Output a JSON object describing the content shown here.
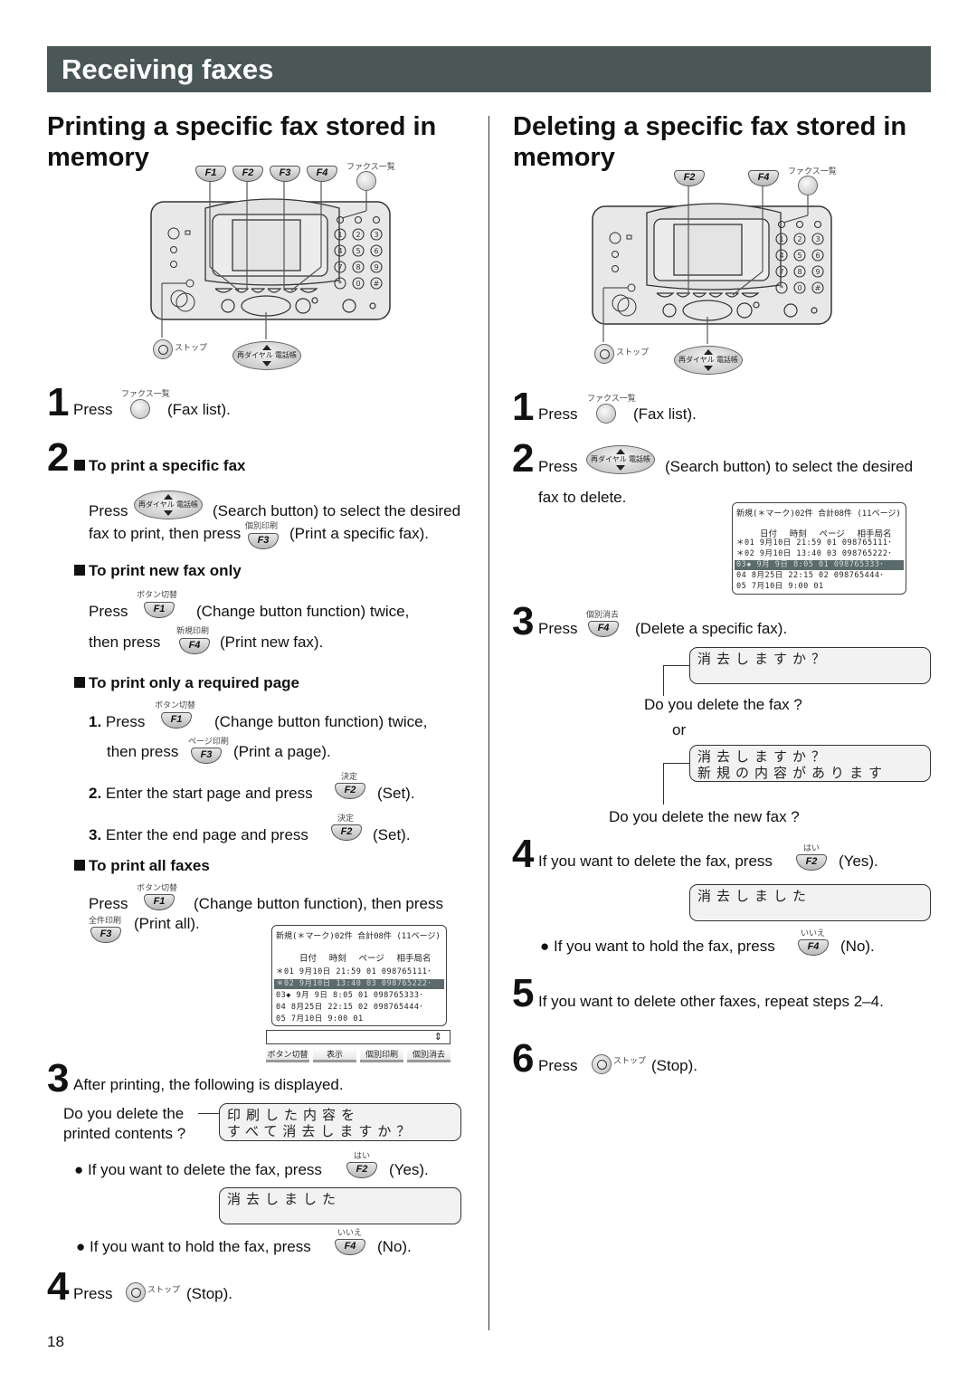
{
  "header": {
    "title": "Receiving faxes"
  },
  "left": {
    "title_line1": "Printing a specific fax stored in",
    "title_line2": "memory",
    "diagram": {
      "fkeys": [
        "F1",
        "F2",
        "F3",
        "F4"
      ],
      "fax_list_label": "ファクス一覧",
      "stop_label": "ストップ",
      "search_label": "再ダイヤル 電話帳"
    },
    "step1": {
      "num": "1",
      "press": "Press",
      "btn_label": "ファクス一覧",
      "desc": "(Fax list)."
    },
    "step2": {
      "num": "2",
      "sub1": {
        "heading": "To print a specific fax",
        "line1_press": "Press",
        "search_label": "再ダイヤル 電話帳",
        "line1_desc": "(Search button) to select the desired",
        "line2_pre": "fax to print, then press",
        "key_jp": "個別印刷",
        "key": "F3",
        "line2_desc": "(Print a specific fax)."
      },
      "sub2": {
        "heading": "To print new fax only",
        "line1_press": "Press",
        "key1_jp": "ボタン切替",
        "key1": "F1",
        "line1_desc": "(Change button function) twice,",
        "line2_pre": "then press",
        "key2_jp": "新規印刷",
        "key2": "F4",
        "line2_desc": "(Print new fax)."
      },
      "sub3": {
        "heading": "To print only a required page",
        "s1_num": "1.",
        "s1_press": "Press",
        "s1_key_jp": "ボタン切替",
        "s1_key": "F1",
        "s1_desc": "(Change button function) twice,",
        "s1b_pre": "then press",
        "s1b_key_jp": "ページ印刷",
        "s1b_key": "F3",
        "s1b_desc": "(Print a page).",
        "s2_num": "2.",
        "s2_text": "Enter the start page and press",
        "s2_key_jp": "決定",
        "s2_key": "F2",
        "s2_desc": "(Set).",
        "s3_num": "3.",
        "s3_text": "Enter the end page and press",
        "s3_key_jp": "決定",
        "s3_key": "F2",
        "s3_desc": "(Set)."
      },
      "sub4": {
        "heading": "To print all faxes",
        "line1_press": "Press",
        "key1_jp": "ボタン切替",
        "key1": "F1",
        "line1_desc": "(Change button function), then press",
        "key2_jp": "全件印刷",
        "key2": "F3",
        "line2_desc": "(Print all)."
      }
    },
    "fax_screen": {
      "header": "新規(＊マーク)02件  合計08件 (11ページ)",
      "columns": "日付  時刻 ページ 相手局名",
      "rows": [
        {
          "text": "＊01  9月10日 21:59 01 098765111･",
          "selected": false
        },
        {
          "text": "＊02  9月10日 13:40 03 098765222･",
          "selected": true
        },
        {
          "text": " 03◆ 9月 9日  8:05 01 098765333･",
          "selected": false
        },
        {
          "text": " 04  8月25日 22:15 02 098765444･",
          "selected": false
        },
        {
          "text": " 05  7月10日  9:00 01",
          "selected": false
        }
      ],
      "scroll_icon": "⇕",
      "softkeys": [
        "ボタン切替",
        "表示",
        "個別印刷",
        "個別消去"
      ]
    },
    "step3": {
      "num": "3",
      "text": "After printing, the following is displayed.",
      "caption_line1": "Do you delete the",
      "caption_line2": "printed contents ?",
      "lcd1_line1": "印刷した内容を",
      "lcd1_line2": "すべて消去しますか？",
      "yes_text": "If you want to delete the fax, press",
      "yes_key_jp": "はい",
      "yes_key": "F2",
      "yes_desc": "(Yes).",
      "lcd2": "消去しました",
      "no_text": "If you want to hold the fax, press",
      "no_key_jp": "いいえ",
      "no_key": "F4",
      "no_desc": "(No)."
    },
    "step4": {
      "num": "4",
      "press": "Press",
      "stop_label": "ストップ",
      "desc": "(Stop)."
    }
  },
  "right": {
    "title_line1": "Deleting a specific fax stored in",
    "title_line2": "memory",
    "diagram": {
      "fkeys": [
        "F2",
        "F4"
      ],
      "fax_list_label": "ファクス一覧",
      "stop_label": "ストップ",
      "search_label": "再ダイヤル 電話帳"
    },
    "step1": {
      "num": "1",
      "press": "Press",
      "btn_label": "ファクス一覧",
      "desc": "(Fax list)."
    },
    "step2": {
      "num": "2",
      "press": "Press",
      "search_label": "再ダイヤル 電話帳",
      "desc": "(Search button) to select the desired",
      "line2": "fax to delete."
    },
    "fax_screen": {
      "header": "新規(＊マーク)02件  合計08件 (11ページ)",
      "columns": "日付  時刻 ページ 相手局名",
      "rows": [
        {
          "text": "＊01  9月10日 21:59 01 098765111･",
          "selected": false
        },
        {
          "text": "＊02  9月10日 13:40 03 098765222･",
          "selected": false
        },
        {
          "text": " 03◆ 9月 9日  8:05 01 098765333･",
          "selected": true
        },
        {
          "text": " 04  8月25日 22:15 02 098765444･",
          "selected": false
        },
        {
          "text": " 05  7月10日  9:00 01",
          "selected": false
        }
      ]
    },
    "step3": {
      "num": "3",
      "press": "Press",
      "key_jp": "個別消去",
      "key": "F4",
      "desc": "(Delete a specific fax).",
      "lcd1": "消去しますか？",
      "caption1": "Do you delete the fax ?",
      "or": "or",
      "lcd2_line1": "消去しますか？",
      "lcd2_line2": "新規の内容があります",
      "caption2": "Do you delete the new fax ?"
    },
    "step4": {
      "num": "4",
      "text": "If you want to delete the fax, press",
      "key_jp": "はい",
      "key": "F2",
      "desc": "(Yes).",
      "lcd": "消去しました",
      "no_text": "If you want to hold the fax, press",
      "no_key_jp": "いいえ",
      "no_key": "F4",
      "no_desc": "(No)."
    },
    "step5": {
      "num": "5",
      "text": "If you want to delete other faxes, repeat steps 2–4."
    },
    "step6": {
      "num": "6",
      "press": "Press",
      "stop_label": "ストップ",
      "desc": "(Stop)."
    }
  },
  "footer": {
    "page_number": "18"
  }
}
